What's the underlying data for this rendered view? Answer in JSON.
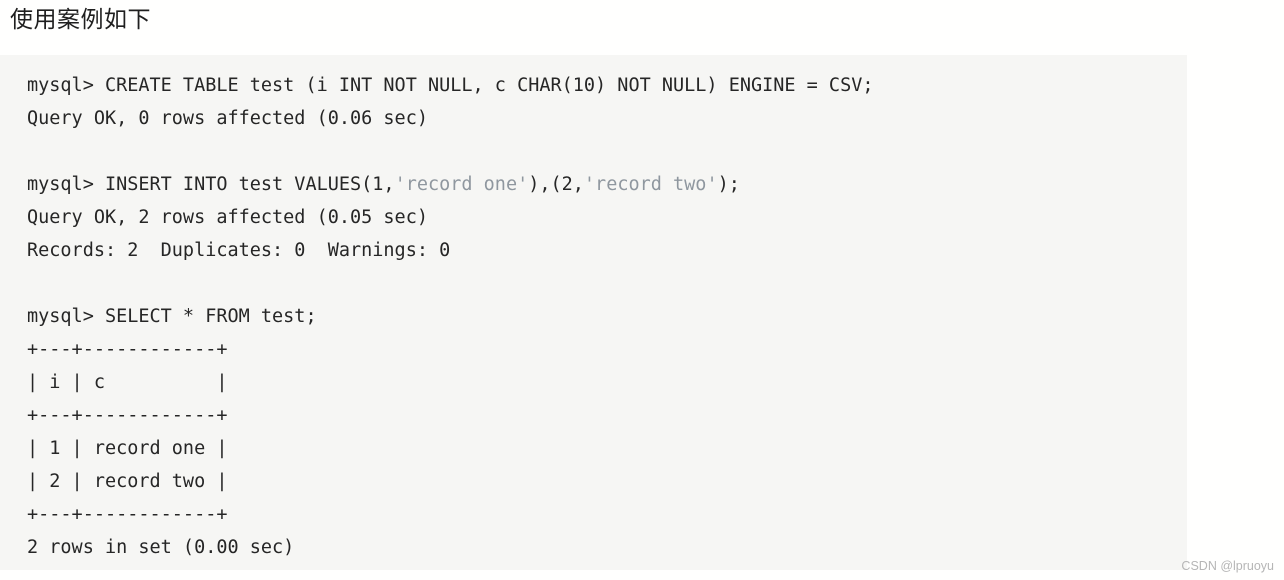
{
  "heading": "使用案例如下",
  "code_block": {
    "language": "sql-console",
    "background_color": "#f6f6f4",
    "text_color": "#262626",
    "string_color": "#8f979f",
    "lines": [
      {
        "id": "line-1",
        "text": "mysql> CREATE TABLE test (i INT NOT NULL, c CHAR(10) NOT NULL) ENGINE = CSV;"
      },
      {
        "id": "line-2",
        "text": "Query OK, 0 rows affected (0.06 sec)"
      },
      {
        "id": "line-3",
        "text": ""
      },
      {
        "id": "line-4",
        "text": "mysql> INSERT INTO test VALUES(1,'record one'),(2,'record two');",
        "segments": [
          {
            "text": "mysql> INSERT INTO test VALUES(1,",
            "kind": "plain"
          },
          {
            "text": "'record one'",
            "kind": "string"
          },
          {
            "text": "),(2,",
            "kind": "plain"
          },
          {
            "text": "'record two'",
            "kind": "string"
          },
          {
            "text": ");",
            "kind": "plain"
          }
        ]
      },
      {
        "id": "line-5",
        "text": "Query OK, 2 rows affected (0.05 sec)"
      },
      {
        "id": "line-6",
        "text": "Records: 2  Duplicates: 0  Warnings: 0"
      },
      {
        "id": "line-7",
        "text": ""
      },
      {
        "id": "line-8",
        "text": "mysql> SELECT * FROM test;"
      },
      {
        "id": "line-9",
        "text": "+---+------------+"
      },
      {
        "id": "line-10",
        "text": "| i | c          |"
      },
      {
        "id": "line-11",
        "text": "+---+------------+"
      },
      {
        "id": "line-12",
        "text": "| 1 | record one |"
      },
      {
        "id": "line-13",
        "text": "| 2 | record two |"
      },
      {
        "id": "line-14",
        "text": "+---+------------+"
      },
      {
        "id": "line-15",
        "text": "2 rows in set (0.00 sec)"
      }
    ],
    "result_table": {
      "columns": [
        "i",
        "c"
      ],
      "rows": [
        [
          "1",
          "record one"
        ],
        [
          "2",
          "record two"
        ]
      ],
      "row_count_text": "2 rows in set (0.00 sec)"
    }
  },
  "watermark": "CSDN @lpruoyu"
}
